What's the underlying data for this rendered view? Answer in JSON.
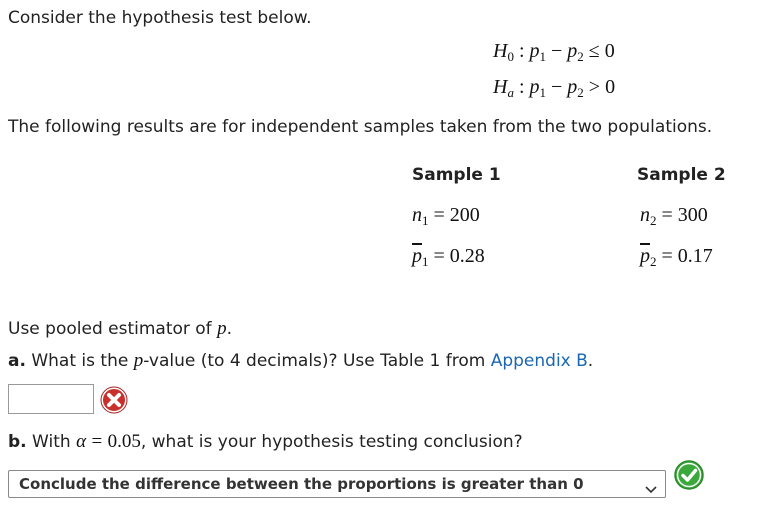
{
  "intro": "Consider the hypothesis test below.",
  "hypotheses": {
    "h0": {
      "symbol": "H",
      "sub": "0",
      "lhs": "p",
      "sub1": "1",
      "minus": "−",
      "p2": "p",
      "sub2": "2",
      "rel": "≤",
      "rhs": "0"
    },
    "ha": {
      "symbol": "H",
      "sub": "a",
      "lhs": "p",
      "sub1": "1",
      "minus": "−",
      "p2": "p",
      "sub2": "2",
      "rel": ">",
      "rhs": "0"
    }
  },
  "results_text": "The following results are for independent samples taken from the two populations.",
  "table": {
    "headers": [
      "Sample 1",
      "Sample 2"
    ],
    "n": [
      {
        "var": "n",
        "sub": "1",
        "value": "200"
      },
      {
        "var": "n",
        "sub": "2",
        "value": "300"
      }
    ],
    "pbar": [
      {
        "var": "p",
        "sub": "1",
        "value": "0.28"
      },
      {
        "var": "p",
        "sub": "2",
        "value": "0.17"
      }
    ]
  },
  "pooled_text": "Use pooled estimator of",
  "pooled_var": "p",
  "question_a": {
    "label": "a.",
    "text_before": "What is the",
    "var": "p",
    "text_after": "-value (to 4 decimals)? Use Table 1 from",
    "link": "Appendix B",
    "end": ".",
    "answer_value": "",
    "status_icon": "x-circle-icon",
    "status_color": "#cc3333"
  },
  "question_b": {
    "label": "b.",
    "text_before": "With",
    "alpha": "α",
    "eq": "=",
    "alpha_value": "0.05",
    "text_after": ", what is your hypothesis testing conclusion?",
    "selected": "Conclude the difference between the proportions is greater than 0",
    "status_icon": "check-circle-icon",
    "status_color": "#3aa83a"
  }
}
